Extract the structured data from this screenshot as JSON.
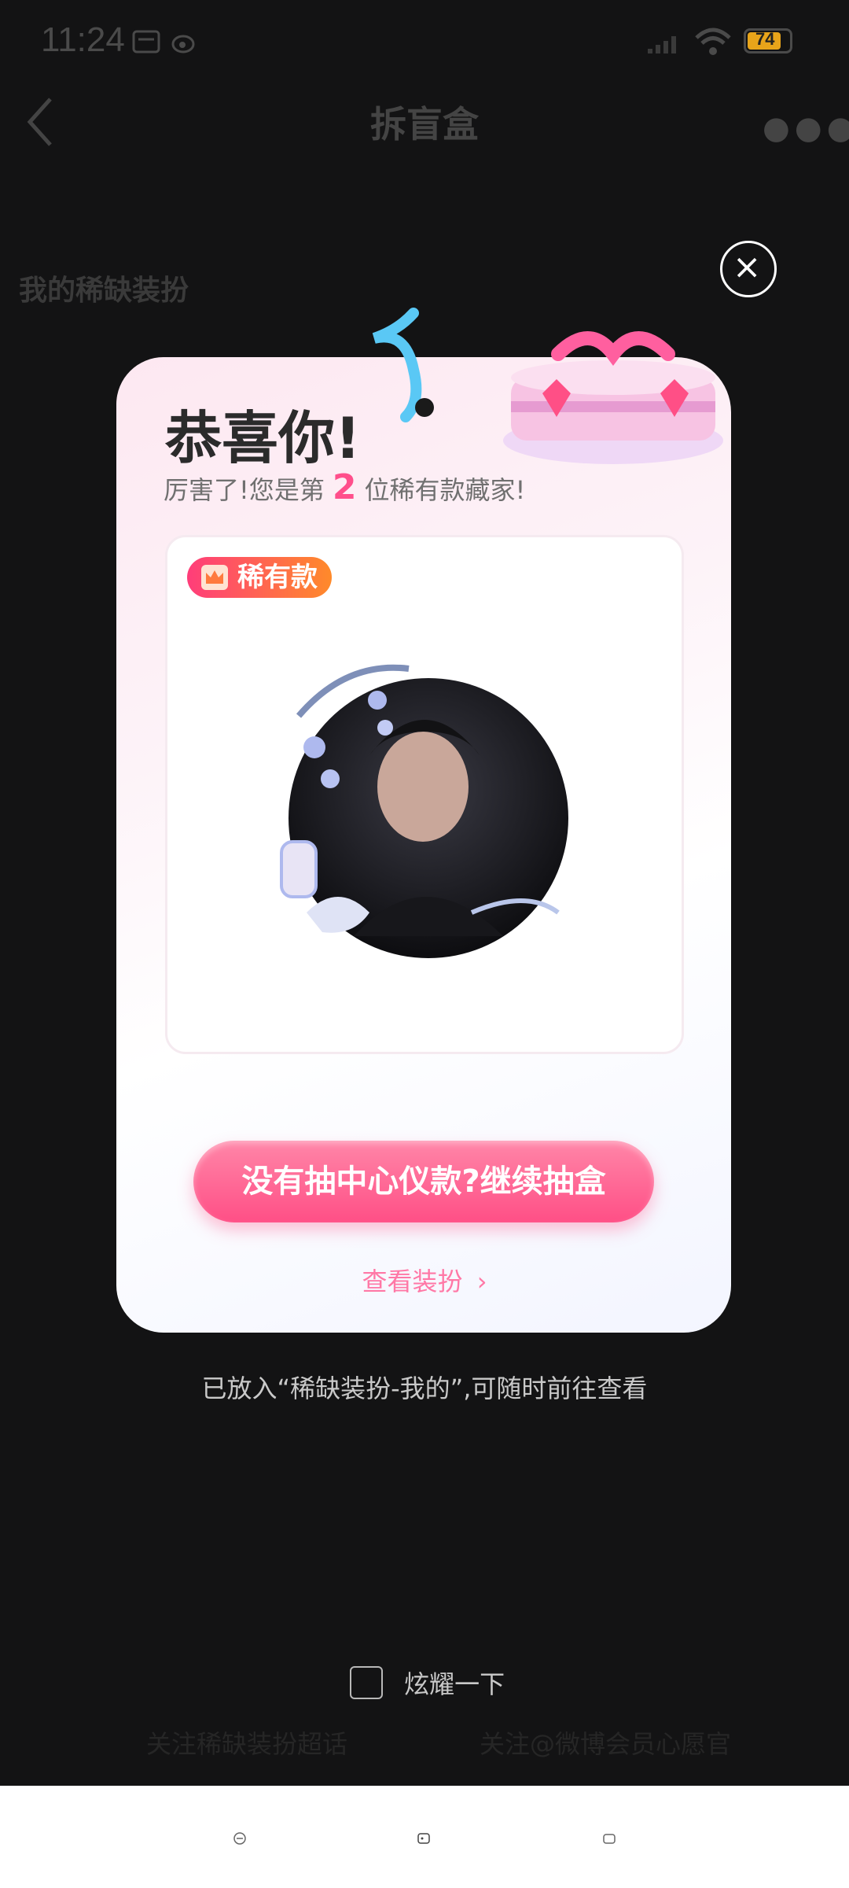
{
  "status_bar": {
    "time": "11:24",
    "battery": "74"
  },
  "header": {
    "title": "拆盲盒"
  },
  "background": {
    "section_title": "我的稀缺装扮",
    "follow_topic": "关注稀缺装扮超话",
    "follow_account": "关注@微博会员心愿官"
  },
  "dialog": {
    "title": "恭喜你!",
    "subtitle_prefix": "厉害了!您是第",
    "rank": "2",
    "subtitle_suffix": "位稀有款藏家!",
    "badge": "稀有款",
    "primary_button": "没有抽中心仪款?继续抽盒",
    "view_link": "查看装扮",
    "info": "已放入“稀缺装扮-我的”,可随时前往查看"
  },
  "show_off": {
    "label": "炫耀一下",
    "checked": false
  },
  "colors": {
    "accent": "#ff4f86",
    "badge_start": "#ff3d7a",
    "badge_end": "#ff8a2a"
  }
}
